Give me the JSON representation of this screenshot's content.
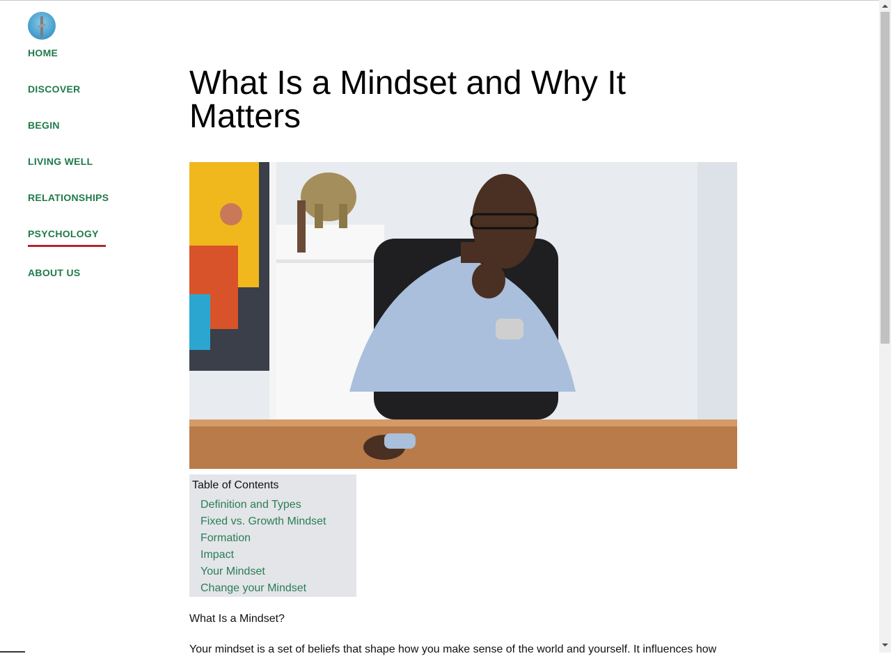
{
  "nav": {
    "items": [
      {
        "label": "HOME"
      },
      {
        "label": "DISCOVER"
      },
      {
        "label": "BEGIN"
      },
      {
        "label": "LIVING WELL"
      },
      {
        "label": "RELATIONSHIPS"
      },
      {
        "label": "PSYCHOLOGY",
        "active": true
      },
      {
        "label": "ABOUT US"
      }
    ]
  },
  "article": {
    "title": "What Is a Mindset and Why It Matters",
    "toc": {
      "heading": "Table of Contents",
      "links": [
        "Definition and Types",
        "Fixed vs. Growth Mindset",
        "Formation",
        "Impact",
        "Your Mindset",
        "Change your Mindset"
      ]
    },
    "section_heading": "What Is a Mindset?",
    "body_start": "Your mindset is a set of beliefs that shape how you make sense of the world and yourself. It influences how"
  },
  "colors": {
    "nav_green": "#1f7a4a",
    "link_green": "#2b7d55",
    "active_underline": "#b3262b",
    "toc_background": "#e3e5e8"
  }
}
